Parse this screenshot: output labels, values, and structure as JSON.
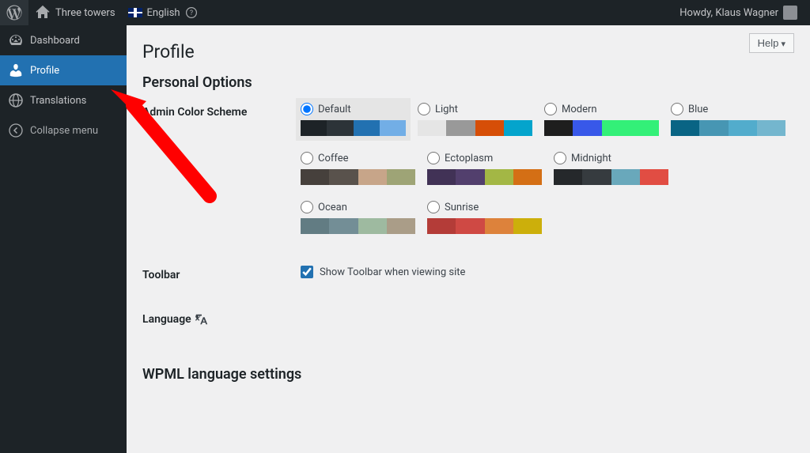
{
  "adminbar": {
    "site_name": "Three towers",
    "language": "English",
    "howdy": "Howdy, Klaus Wagner"
  },
  "sidebar": {
    "items": [
      {
        "label": "Dashboard"
      },
      {
        "label": "Profile"
      },
      {
        "label": "Translations"
      }
    ],
    "collapse": "Collapse menu"
  },
  "content": {
    "help": "Help",
    "title": "Profile",
    "section_personal": "Personal Options",
    "label_color_scheme": "Admin Color Scheme",
    "label_toolbar": "Toolbar",
    "toolbar_checkbox": "Show Toolbar when viewing site",
    "label_language": "Language",
    "section_wpml": "WPML language settings",
    "schemes": [
      {
        "name": "Default",
        "selected": true,
        "colors": [
          "#1d2327",
          "#2c3338",
          "#2271b1",
          "#72aee6"
        ]
      },
      {
        "name": "Light",
        "selected": false,
        "colors": [
          "#e5e5e5",
          "#999999",
          "#d64e07",
          "#04a4cc"
        ]
      },
      {
        "name": "Modern",
        "selected": false,
        "colors": [
          "#1e1e1e",
          "#3858e9",
          "#33f078",
          "#33f078"
        ]
      },
      {
        "name": "Blue",
        "selected": false,
        "colors": [
          "#096484",
          "#4796b3",
          "#52accc",
          "#74b6ce"
        ]
      },
      {
        "name": "Coffee",
        "selected": false,
        "colors": [
          "#46403c",
          "#59524c",
          "#c7a589",
          "#9ea476"
        ]
      },
      {
        "name": "Ectoplasm",
        "selected": false,
        "colors": [
          "#413256",
          "#523f6d",
          "#a3b745",
          "#d46f15"
        ]
      },
      {
        "name": "Midnight",
        "selected": false,
        "colors": [
          "#25282b",
          "#363b3f",
          "#69a8bb",
          "#e14d43"
        ]
      },
      {
        "name": "Ocean",
        "selected": false,
        "colors": [
          "#627c83",
          "#738e96",
          "#9ebaa0",
          "#aa9d88"
        ]
      },
      {
        "name": "Sunrise",
        "selected": false,
        "colors": [
          "#b43c38",
          "#cf4944",
          "#dd823b",
          "#ccaf0b"
        ]
      }
    ]
  }
}
